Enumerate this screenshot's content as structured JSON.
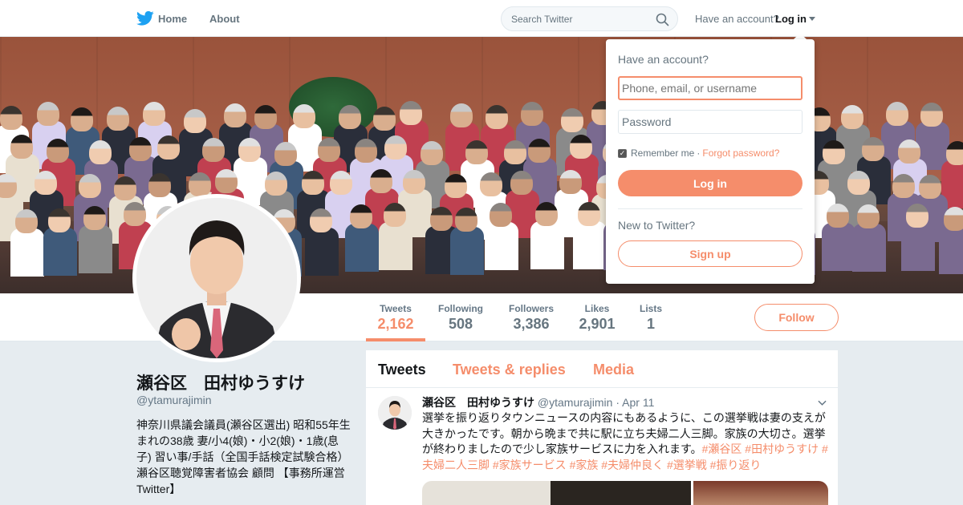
{
  "nav": {
    "home": "Home",
    "about": "About",
    "search_placeholder": "Search Twitter",
    "have_account": "Have an account?",
    "login": "Log in"
  },
  "profile": {
    "name": "瀬谷区　田村ゆうすけ",
    "handle": "@ytamurajimin",
    "bio": "神奈川県議会議員(瀬谷区選出) 昭和55年生まれの38歳 妻/小4(娘)・小2(娘)・1歳(息子) 習い事/手話（全国手話検定試験合格）瀬谷区聴覚障害者協会 顧問 【事務所運営Twitter】"
  },
  "stats": [
    {
      "label": "Tweets",
      "value": "2,162"
    },
    {
      "label": "Following",
      "value": "508"
    },
    {
      "label": "Followers",
      "value": "3,386"
    },
    {
      "label": "Likes",
      "value": "2,901"
    },
    {
      "label": "Lists",
      "value": "1"
    }
  ],
  "follow_label": "Follow",
  "timeline": {
    "tabs": [
      "Tweets",
      "Tweets & replies",
      "Media"
    ],
    "tweet": {
      "name": "瀬谷区　田村ゆうすけ",
      "handle": "@ytamurajimin",
      "separator": "·",
      "date": "Apr 11",
      "text": "選挙を振り返りタウンニュースの内容にもあるように、この選挙戦は妻の支えが大きかったです。朝から晩まで共に駅に立ち夫婦二人三脚。家族の大切さ。選挙が終わりましたので少し家族サービスに力を入れます。",
      "hashtags": [
        "#瀬谷区",
        "#田村ゆうすけ",
        "#夫婦二人三脚",
        "#家族サービス",
        "#家族",
        "#夫婦仲良く",
        "#選挙戦",
        "#振り返り"
      ]
    }
  },
  "login_dropdown": {
    "title": "Have an account?",
    "username_placeholder": "Phone, email, or username",
    "password_placeholder": "Password",
    "remember": "Remember me",
    "separator": "·",
    "forgot": "Forgot password?",
    "login_button": "Log in",
    "new_to": "New to Twitter?",
    "signup_button": "Sign up"
  },
  "colors": {
    "accent": "#f58d6b",
    "twitter_blue": "#1da1f2",
    "text_secondary": "#657786"
  }
}
